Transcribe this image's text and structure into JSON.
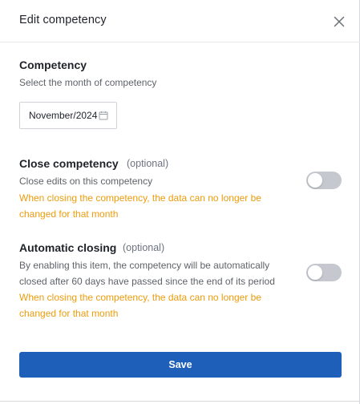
{
  "header": {
    "title": "Edit competency",
    "close_icon": "close-icon"
  },
  "competency": {
    "title": "Competency",
    "description": "Select the month of competency",
    "date_value": "November/2024",
    "calendar_icon": "calendar-icon"
  },
  "close_competency": {
    "title": "Close competency",
    "optional": "(optional)",
    "description": "Close edits on this competency",
    "warning_line1": "When closing the competency, the data can no longer be",
    "warning_line2": "changed for that month",
    "enabled": false
  },
  "automatic_closing": {
    "title": "Automatic closing",
    "optional": "(optional)",
    "description_line1": "By enabling this item, the competency will be automatically",
    "description_line2": "closed after 60 days have passed since the end of its period",
    "warning_line1": "When closing the competency, the data can no longer be",
    "warning_line2": "changed for that month",
    "enabled": false
  },
  "footer": {
    "save_label": "Save"
  },
  "colors": {
    "primary": "#1d5fb9",
    "warning": "#ec9c0c",
    "toggle_off": "#c5c9cf"
  }
}
